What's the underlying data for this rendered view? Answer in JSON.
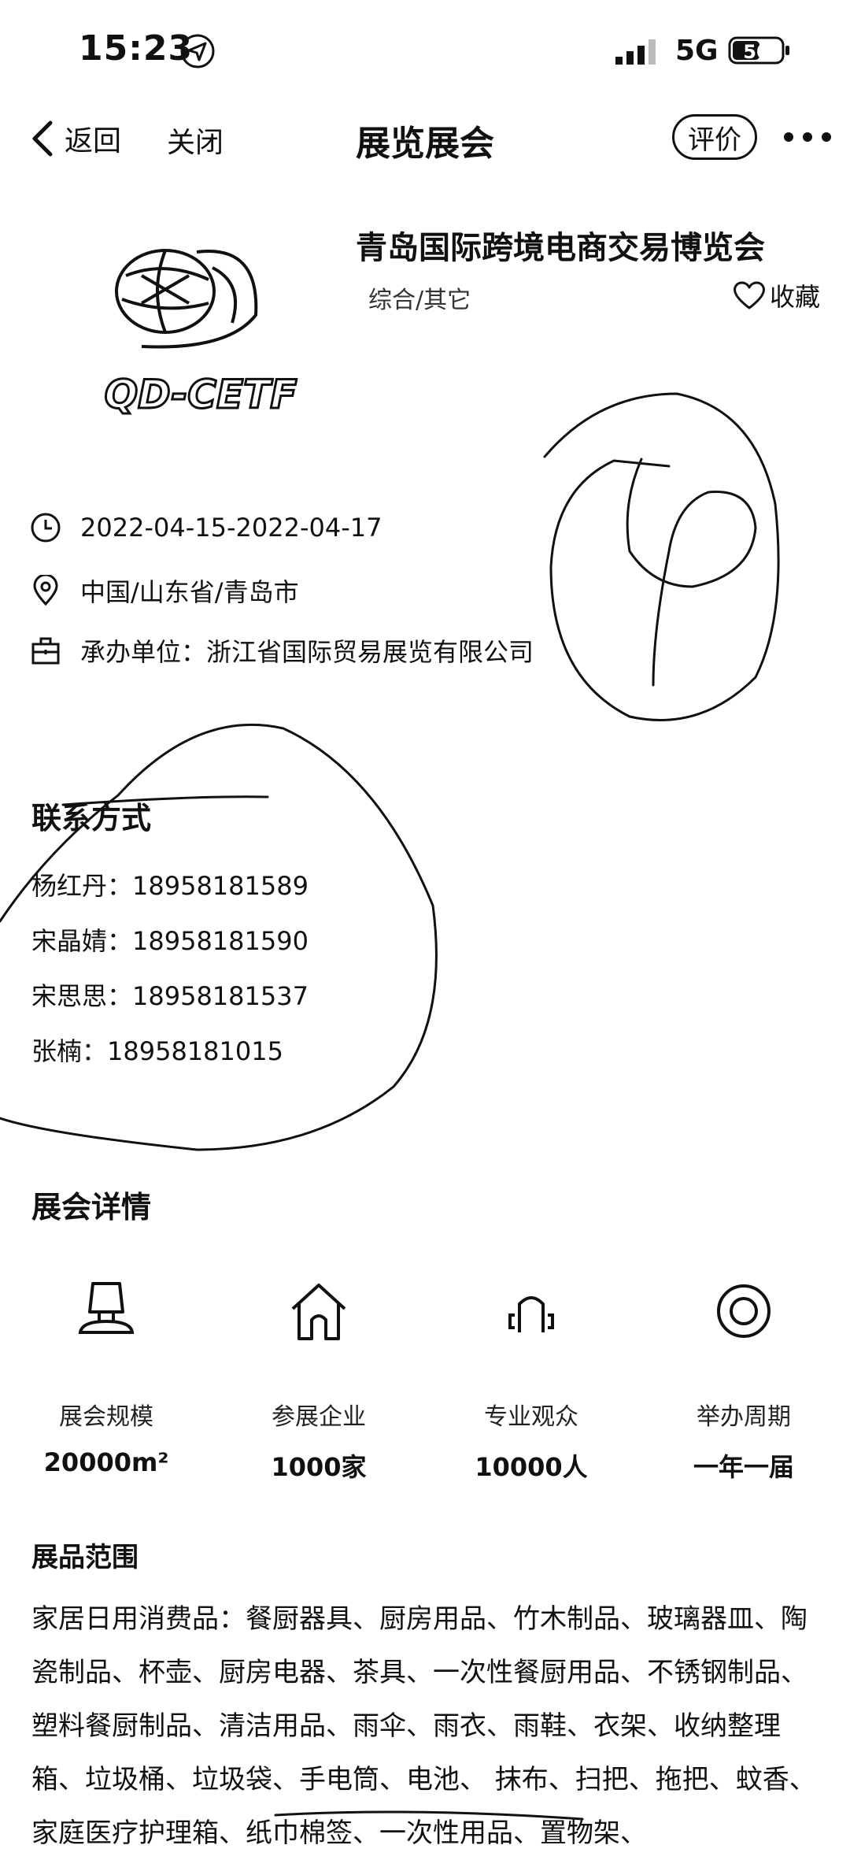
{
  "status_bar": {
    "time": "15:23",
    "network": "5G",
    "battery": "50"
  },
  "nav": {
    "back_label": "返回",
    "close_label": "关闭",
    "title": "展览展会",
    "rate_label": "评价"
  },
  "expo": {
    "logo_text": "QD-CETF",
    "title": "青岛国际跨境电商交易博览会",
    "category": "综合/其它",
    "favorite_label": "收藏",
    "date": "2022-04-15-2022-04-17",
    "location": "中国/山东省/青岛市",
    "organizer": "承办单位：浙江省国际贸易展览有限公司"
  },
  "contacts": {
    "title": "联系方式",
    "items": [
      "杨红丹：18958181589",
      "宋晶婧：18958181590",
      "宋思思：18958181537",
      "张楠：18958181015"
    ]
  },
  "details": {
    "title": "展会详情",
    "stats": [
      {
        "label": "展会规模",
        "value": "20000m²",
        "icon": "lamp-icon"
      },
      {
        "label": "参展企业",
        "value": "1000家",
        "icon": "house-icon"
      },
      {
        "label": "专业观众",
        "value": "10000人",
        "icon": "audience-icon"
      },
      {
        "label": "举办周期",
        "value": "一年一届",
        "icon": "cycle-icon"
      }
    ]
  },
  "range": {
    "title": "展品范围",
    "text": "家居日用消费品：餐厨器具、厨房用品、竹木制品、玻璃器皿、陶瓷制品、杯壶、厨房电器、茶具、一次性餐厨用品、不锈钢制品、塑料餐厨制品、清洁用品、雨伞、雨衣、雨鞋、衣架、收纳整理箱、垃圾桶、垃圾袋、手电筒、电池、 抹布、扫把、拖把、蚊香、家庭医疗护理箱、纸巾棉签、一次性用品、置物架、"
  }
}
